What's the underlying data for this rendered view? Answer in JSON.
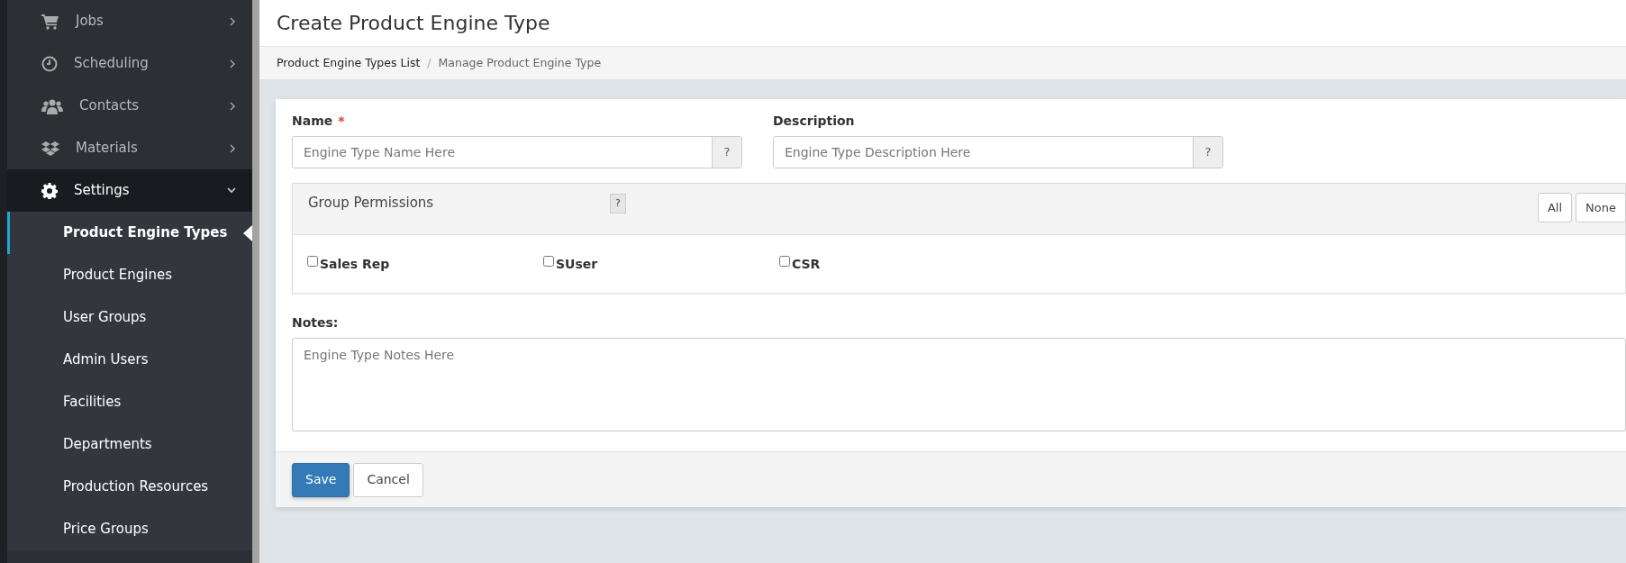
{
  "sidebar": {
    "items": [
      {
        "label": "Jobs",
        "expanded": false
      },
      {
        "label": "Scheduling",
        "expanded": false
      },
      {
        "label": "Contacts",
        "expanded": false
      },
      {
        "label": "Materials",
        "expanded": false
      },
      {
        "label": "Settings",
        "expanded": true,
        "children": [
          {
            "label": "Product Engine Types",
            "selected": true
          },
          {
            "label": "Product Engines",
            "selected": false
          },
          {
            "label": "User Groups",
            "selected": false
          },
          {
            "label": "Admin Users",
            "selected": false
          },
          {
            "label": "Facilities",
            "selected": false
          },
          {
            "label": "Departments",
            "selected": false
          },
          {
            "label": "Production Resources",
            "selected": false
          },
          {
            "label": "Price Groups",
            "selected": false
          }
        ]
      }
    ]
  },
  "page": {
    "title": "Create Product Engine Type",
    "breadcrumb": [
      {
        "label": "Product Engine Types List",
        "kind": "link"
      },
      {
        "label": "/",
        "kind": "separator"
      },
      {
        "label": "Manage Product Engine Type",
        "kind": "current"
      }
    ]
  },
  "form": {
    "fields": [
      {
        "label": "Name",
        "required_mark": "*",
        "placeholder": "Engine Type Name Here",
        "help": "?"
      },
      {
        "label": "Description",
        "placeholder": "Engine Type Description Here",
        "help": "?"
      }
    ],
    "permissions": {
      "title": "Group Permissions",
      "help": "?",
      "buttons": [
        "All",
        "None"
      ],
      "groups": [
        {
          "label": "Sales Rep",
          "checked": false
        },
        {
          "label": "SUser",
          "checked": false
        },
        {
          "label": "CSR",
          "checked": false
        }
      ]
    },
    "notes": {
      "label": "Notes:",
      "placeholder": "Engine Type Notes Here"
    },
    "buttons": [
      {
        "label": "Save",
        "kind": "primary"
      },
      {
        "label": "Cancel",
        "kind": "secondary"
      }
    ]
  }
}
